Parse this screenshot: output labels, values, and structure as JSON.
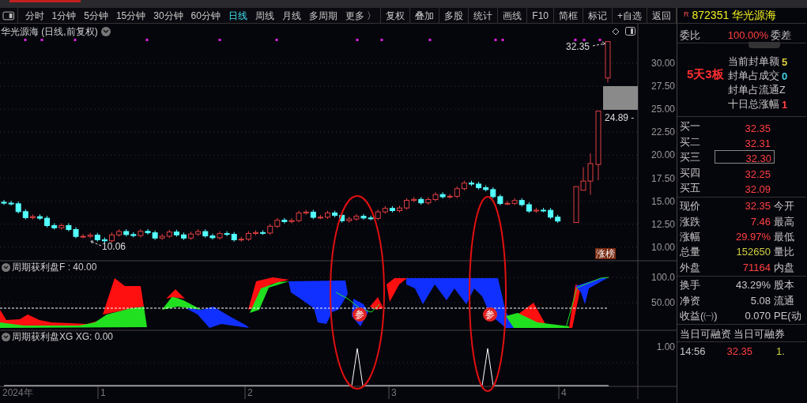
{
  "toolbar": {
    "periods": [
      {
        "label": "分时",
        "selected": false
      },
      {
        "label": "1分钟",
        "selected": false
      },
      {
        "label": "5分钟",
        "selected": false
      },
      {
        "label": "15分钟",
        "selected": false
      },
      {
        "label": "30分钟",
        "selected": false
      },
      {
        "label": "60分钟",
        "selected": false
      },
      {
        "label": "日线",
        "selected": true
      },
      {
        "label": "周线",
        "selected": false
      },
      {
        "label": "月线",
        "selected": false
      },
      {
        "label": "多周期",
        "selected": false
      },
      {
        "label": "更多 〉",
        "selected": false
      }
    ],
    "actions": [
      "复权",
      "叠加",
      "多股",
      "统计",
      "画线",
      "F10",
      "简框",
      "标记",
      "+自选",
      "返回"
    ]
  },
  "chart": {
    "title": "华光源海 (日线,前复权)",
    "high_label": "32.35",
    "low_label": "10.06",
    "gap_label": "24.89 -",
    "badge": "涨榜",
    "price_axis": [
      "30.00",
      "27.50",
      "25.00",
      "22.50",
      "20.00",
      "17.50",
      "15.00",
      "12.50",
      "10.00"
    ],
    "indicator": {
      "label": "周期获利盘F : 40.00",
      "axis": [
        "100.0",
        "50.00"
      ],
      "markers": [
        "参",
        "参"
      ]
    },
    "xg": {
      "label": "周期获利盘XG  XG: 0.00",
      "axis": [
        "1.00"
      ]
    },
    "time_axis": [
      "2024年",
      "1",
      "2",
      "3",
      "4"
    ]
  },
  "quote_panel": {
    "code_mark": "R",
    "code": "872351",
    "name": "华光源海",
    "ratio": {
      "label": "委比",
      "value": "100.00%",
      "label2": "委差"
    },
    "limit_tag": "5天3板",
    "seal_stats": [
      {
        "label": "当前封单额",
        "value": "5",
        "color": "#e0d040"
      },
      {
        "label": "封单占成交",
        "value": "0",
        "color": "#40d0e0"
      },
      {
        "label": "封单占流通Z"
      },
      {
        "label": "十日总涨幅",
        "value": "1",
        "color": "#ff4040"
      }
    ],
    "order_book": [
      {
        "label": "买一",
        "price": "32.35",
        "selected": false
      },
      {
        "label": "买二",
        "price": "32.31",
        "selected": false
      },
      {
        "label": "买三",
        "price": "32.30",
        "selected": true
      },
      {
        "label": "买四",
        "price": "32.25",
        "selected": false
      },
      {
        "label": "买五",
        "price": "32.09",
        "selected": false
      }
    ],
    "quotes": [
      {
        "label": "现价",
        "value": "32.35",
        "label2": "今开",
        "color": "#ff4040"
      },
      {
        "label": "涨跌",
        "value": "7.46",
        "label2": "最高",
        "color": "#ff4040"
      },
      {
        "label": "涨幅",
        "value": "29.97%",
        "label2": "最低",
        "color": "#ff4040"
      },
      {
        "label": "总量",
        "value": "152650",
        "label2": "量比",
        "color": "#d0d040"
      },
      {
        "label": "外盘",
        "value": "71164",
        "label2": "内盘",
        "color": "#ff4040"
      }
    ],
    "fundamentals": [
      {
        "label": "换手",
        "value": "43.29%",
        "label2": "股本"
      },
      {
        "label": "净资",
        "value": "5.08",
        "label2": "流通"
      },
      {
        "label": "收益(㈠)",
        "value": "0.070",
        "label2": "PE(动"
      }
    ],
    "margin": [
      "当日可融资",
      "当日可融券"
    ],
    "ticks": [
      {
        "time": "14:56",
        "price": "32.35",
        "volume": "1."
      }
    ]
  }
}
